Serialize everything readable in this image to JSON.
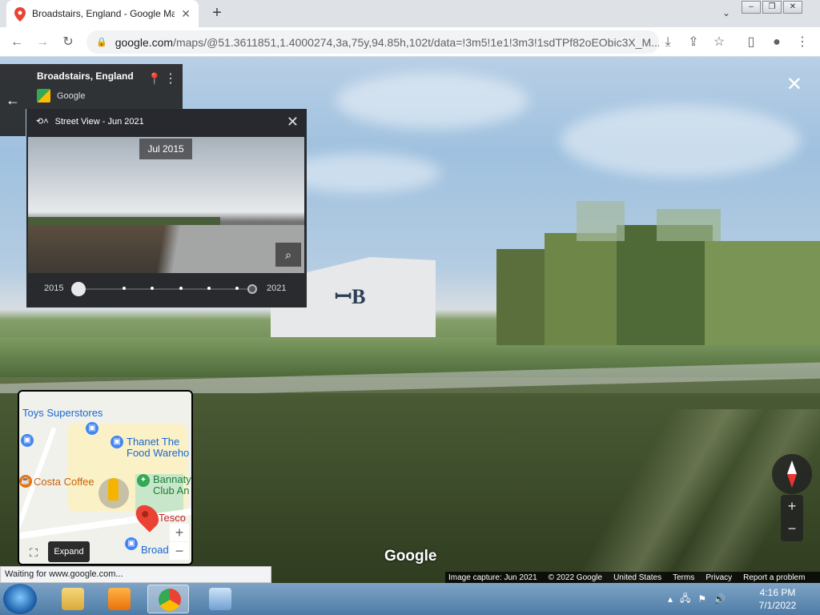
{
  "browser": {
    "tab_title": "Broadstairs, England - Google Maps",
    "new_tab_label": "+",
    "url_host": "google.com",
    "url_path": "/maps/@51.3611851,1.4000274,3a,75y,94.85h,102t/data=!3m5!1e1!3m3!1sdTPf82oEObic3X_M...",
    "status_text": "Waiting for www.google.com..."
  },
  "location_card": {
    "title": "Broadstairs, England",
    "source": "Google"
  },
  "time_travel": {
    "header": "Street View - Jun 2021",
    "thumbnail_date": "Jul 2015",
    "start_year": "2015",
    "end_year": "2021",
    "selected_position": 0.0,
    "tick_count": 7
  },
  "minimap": {
    "labels": {
      "toys": "Toys Superstores",
      "thanet": "Thanet The",
      "food": "Food Wareho",
      "costa": "Costa Coffee",
      "bannatyne": "Bannaty",
      "club": "Club An",
      "tesco": "Tesco",
      "broad": "Broad"
    },
    "expand_tooltip": "Expand",
    "zoom_in": "+",
    "zoom_out": "−"
  },
  "street_view": {
    "watermark": "Google",
    "zoom_in": "+",
    "zoom_out": "−",
    "footer": {
      "capture": "Image capture: Jun 2021",
      "copyright": "© 2022 Google",
      "region": "United States",
      "terms": "Terms",
      "privacy": "Privacy",
      "report": "Report a problem"
    }
  },
  "taskbar": {
    "time": "4:16 PM",
    "date": "7/1/2022"
  },
  "colors": {
    "maps_red": "#ea4335",
    "poi_blue": "#4285f4",
    "poi_orange": "#e8710a",
    "poi_green": "#34a853"
  }
}
